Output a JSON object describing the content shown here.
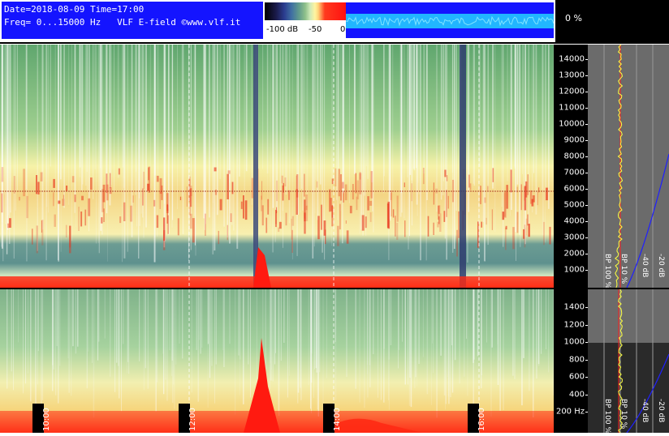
{
  "header": {
    "date_line": "Date=2018-08-09 Time=17:00",
    "freq_line": "Freq= 0...15000 Hz   VLF E-field ©www.vlf.it",
    "colorbar_labels": [
      "-100 dB",
      "-50",
      "0"
    ],
    "percent": "0 %"
  },
  "axis_top": {
    "ticks": [
      "14000",
      "13000",
      "12000",
      "11000",
      "10000",
      "9000",
      "8000",
      "7000",
      "6000",
      "5000",
      "4000",
      "3000",
      "2000",
      "1000"
    ]
  },
  "axis_bottom": {
    "ticks": [
      "1400",
      "1200",
      "1000",
      "800",
      "600",
      "400",
      "200 Hz"
    ]
  },
  "profile_top": {
    "labels": [
      "BP 100 %",
      "BP 10 %",
      "-40 dB",
      "-20 dB"
    ]
  },
  "profile_bottom": {
    "labels": [
      "BP 100 %",
      "BP 10 %",
      "-40 dB",
      "-20 dB"
    ]
  },
  "time_labels": [
    "10:00",
    "12:00",
    "14:00",
    "16:00"
  ],
  "colors": {
    "header_blue": "#1414ff",
    "spec_green": "#8fc08a",
    "spec_yellow": "#fff4a0",
    "spec_red": "#ff2a14",
    "profile_bg": "#6b6b6b",
    "profile_yellow": "#ffff40",
    "profile_red": "#ff2020",
    "profile_blue": "#2020ff"
  }
}
